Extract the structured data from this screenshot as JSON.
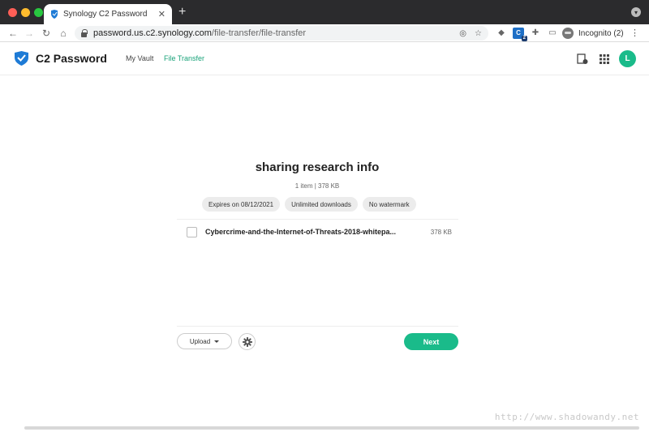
{
  "browser": {
    "tab_title": "Synology C2 Password",
    "tab_close": "✕",
    "new_tab": "+",
    "url_host": "password.us.c2.synology.com",
    "url_path": "/file-transfer/file-transfer",
    "profile_label": "Incognito (2)",
    "extension_badge": "2"
  },
  "app": {
    "brand_name": "C2 Password",
    "nav": [
      {
        "label": "My Vault"
      },
      {
        "label": "File Transfer"
      }
    ],
    "avatar_initial": "L",
    "accent_color": "#1abb8a"
  },
  "transfer": {
    "title": "sharing research info",
    "summary": "1 item | 378 KB",
    "chips": [
      {
        "label": "Expires on 08/12/2021"
      },
      {
        "label": "Unlimited downloads"
      },
      {
        "label": "No watermark"
      }
    ],
    "files": [
      {
        "name": "Cybercrime-and-the-Internet-of-Threats-2018-whitepa...",
        "size": "378 KB"
      }
    ],
    "upload_label": "Upload",
    "next_label": "Next"
  },
  "watermark": "http://www.shadowandy.net"
}
